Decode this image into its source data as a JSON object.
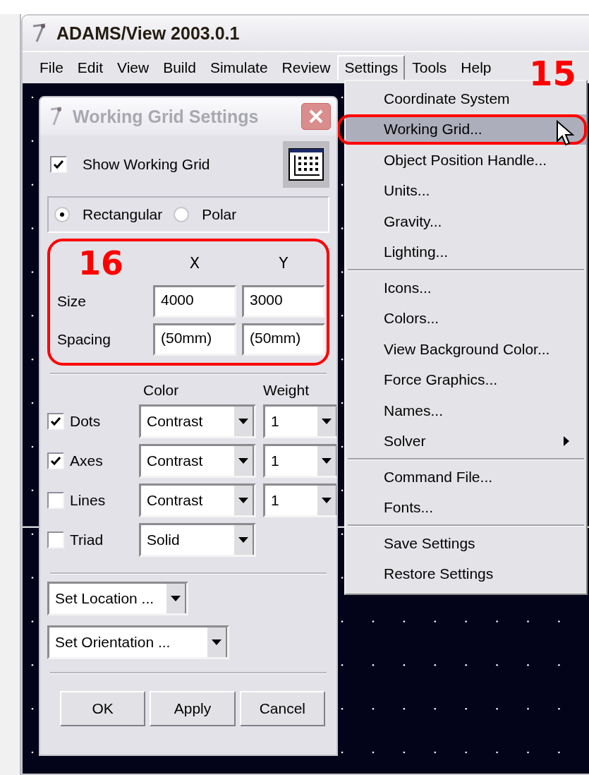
{
  "window": {
    "title": "ADAMS/View 2003.0.1"
  },
  "menu_bar": [
    {
      "label": "File",
      "selected": false
    },
    {
      "label": "Edit",
      "selected": false
    },
    {
      "label": "View",
      "selected": false
    },
    {
      "label": "Build",
      "selected": false
    },
    {
      "label": "Simulate",
      "selected": false
    },
    {
      "label": "Review",
      "selected": false
    },
    {
      "label": "Settings",
      "selected": true
    },
    {
      "label": "Tools",
      "selected": false
    },
    {
      "label": "Help",
      "selected": false
    }
  ],
  "settings_menu": {
    "annotation": "15",
    "sections": [
      [
        {
          "label": "Coordinate System",
          "selected": false,
          "has_submenu": false
        },
        {
          "label": "Working Grid...",
          "selected": true,
          "has_submenu": false
        },
        {
          "label": "Object Position Handle...",
          "selected": false,
          "has_submenu": false
        },
        {
          "label": "Units...",
          "selected": false,
          "has_submenu": false
        },
        {
          "label": "Gravity...",
          "selected": false,
          "has_submenu": false
        },
        {
          "label": "Lighting...",
          "selected": false,
          "has_submenu": false
        }
      ],
      [
        {
          "label": "Icons...",
          "selected": false,
          "has_submenu": false
        },
        {
          "label": "Colors...",
          "selected": false,
          "has_submenu": false
        },
        {
          "label": "View Background Color...",
          "selected": false,
          "has_submenu": false
        },
        {
          "label": "Force Graphics...",
          "selected": false,
          "has_submenu": false
        },
        {
          "label": "Names...",
          "selected": false,
          "has_submenu": false
        },
        {
          "label": "Solver",
          "selected": false,
          "has_submenu": true
        }
      ],
      [
        {
          "label": "Command File...",
          "selected": false,
          "has_submenu": false
        },
        {
          "label": "Fonts...",
          "selected": false,
          "has_submenu": false
        }
      ],
      [
        {
          "label": "Save Settings",
          "selected": false,
          "has_submenu": false
        },
        {
          "label": "Restore Settings",
          "selected": false,
          "has_submenu": false
        }
      ]
    ]
  },
  "dialog": {
    "title": "Working Grid Settings",
    "show_grid": {
      "label": "Show Working Grid",
      "checked": true
    },
    "modes": [
      {
        "label": "Rectangular",
        "selected": true
      },
      {
        "label": "Polar",
        "selected": false
      }
    ],
    "grid": {
      "annotation": "16",
      "columns": [
        "X",
        "Y"
      ],
      "rows": [
        {
          "label": "Size",
          "values": [
            "4000",
            "3000"
          ]
        },
        {
          "label": "Spacing",
          "values": [
            "(50mm)",
            "(50mm)"
          ]
        }
      ]
    },
    "color_header": "Color",
    "weight_header": "Weight",
    "elements": [
      {
        "label": "Dots",
        "checked": true,
        "color_choice": "Contrast",
        "weight": "1"
      },
      {
        "label": "Axes",
        "checked": true,
        "color_choice": "Contrast",
        "weight": "1"
      },
      {
        "label": "Lines",
        "checked": false,
        "color_choice": "Contrast",
        "weight": "1"
      },
      {
        "label": "Triad",
        "checked": false,
        "color_choice": "Solid"
      }
    ],
    "location": "Set Location ...",
    "orientation": "Set Orientation ...",
    "buttons": [
      "OK",
      "Apply",
      "Cancel"
    ]
  }
}
